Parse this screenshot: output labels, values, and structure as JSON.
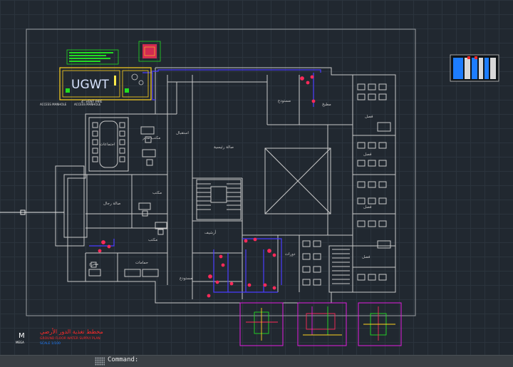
{
  "drawing": {
    "tank_label": "UGWT",
    "tank_note": "4\" VENT PIPE",
    "access_label_left": "ACCESS MANHOLE",
    "access_label_right": "ACCESS MANHOLE",
    "rooms": {
      "storage": "مستودع",
      "pantry": "مطبخ",
      "office_manager": "مكتب مدير",
      "meeting": "اجتماعات",
      "reception": "استقبال",
      "men_hall": "صالة رجال",
      "office": "مكتب",
      "office2": "مكتب",
      "archive": "أرشيف",
      "lobby": "صالة رئيسية",
      "main_hall": "صالة رئيسية",
      "storage2": "مستودع",
      "bath": "حمامات",
      "class1": "فصل",
      "class2": "فصل",
      "class3": "فصل",
      "class4": "فصل",
      "class5": "فصل",
      "toilets": "دورات",
      "office_right": "مكتب",
      "fire_exit": "مخرج"
    },
    "title_block": {
      "logo_letter": "M",
      "logo_caption": "MEGA",
      "title_ar": "مخطط تغذية الدور الأرضي",
      "subtitle": "GROUND FLOOR WATER SUPPLY PLAN",
      "scale": "SCALE 1/100"
    }
  },
  "colors": {
    "background": "#212830",
    "grid": "#2b343d",
    "walls": "#c8c8c8",
    "supply_pipe": "#4a3cff",
    "fixture": "#ff2a5a",
    "tank": "#ffd21e",
    "detail_frame": "#e21ee0",
    "green_note": "#22dd22",
    "title_red": "#ff2a2a"
  },
  "command_line": {
    "prompt": "Command:",
    "value": ""
  }
}
